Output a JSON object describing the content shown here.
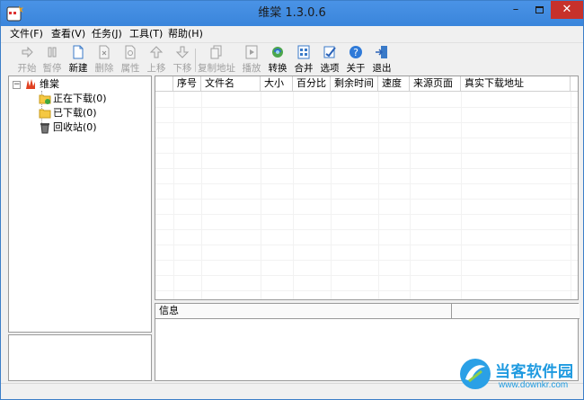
{
  "window": {
    "title": "维棠 1.3.0.6",
    "min_label": "–",
    "close_label": "✕"
  },
  "menu": {
    "items": [
      "文件(F)",
      "查看(V)",
      "任务(J)",
      "工具(T)",
      "帮助(H)"
    ]
  },
  "toolbar": {
    "buttons": [
      {
        "label": "开始",
        "icon": "play-arrow-icon",
        "enabled": false
      },
      {
        "label": "暂停",
        "icon": "pause-icon",
        "enabled": false
      },
      {
        "label": "新建",
        "icon": "new-document-icon",
        "enabled": true
      },
      {
        "label": "删除",
        "icon": "delete-document-icon",
        "enabled": false
      },
      {
        "label": "属性",
        "icon": "properties-icon",
        "enabled": false
      },
      {
        "label": "上移",
        "icon": "arrow-up-icon",
        "enabled": false
      },
      {
        "label": "下移",
        "icon": "arrow-down-icon",
        "enabled": false
      },
      {
        "label": "复制地址",
        "icon": "copy-address-icon",
        "enabled": false
      },
      {
        "label": "播放",
        "icon": "play-video-icon",
        "enabled": false
      },
      {
        "label": "转换",
        "icon": "convert-icon",
        "enabled": true
      },
      {
        "label": "合并",
        "icon": "merge-icon",
        "enabled": true
      },
      {
        "label": "选项",
        "icon": "options-icon",
        "enabled": true
      },
      {
        "label": "关于",
        "icon": "help-icon",
        "enabled": true
      },
      {
        "label": "退出",
        "icon": "exit-icon",
        "enabled": true
      }
    ]
  },
  "tree": {
    "toggle": "−",
    "root": "维棠",
    "children": [
      "正在下载(0)",
      "已下载(0)",
      "回收站(0)"
    ]
  },
  "list": {
    "columns": [
      "",
      "序号",
      "文件名",
      "大小",
      "百分比",
      "剩余时间",
      "速度",
      "来源页面",
      "真实下载地址"
    ]
  },
  "info": {
    "header": "信息"
  },
  "watermark": {
    "title": "当客软件园",
    "url": "www.downkr.com"
  },
  "colors": {
    "titlebar": "#3a85db",
    "close": "#c7312b",
    "watermark": "#1e9ae0"
  }
}
